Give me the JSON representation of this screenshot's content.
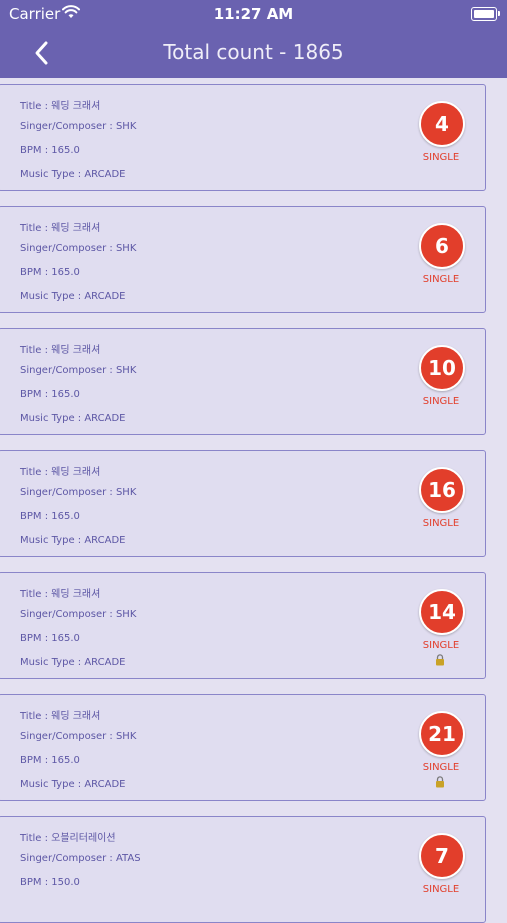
{
  "status_bar": {
    "carrier": "Carrier",
    "time": "11:27 AM"
  },
  "navbar": {
    "title": "Total count - 1865"
  },
  "list": {
    "items": [
      {
        "title": "Title : 웨딩 크래셔",
        "singer": "Singer/Composer : SHK",
        "bpm": "BPM : 165.0",
        "music_type": "Music Type : ARCADE",
        "level": "4",
        "mode": "SINGLE",
        "locked": false
      },
      {
        "title": "Title : 웨딩 크래셔",
        "singer": "Singer/Composer : SHK",
        "bpm": "BPM : 165.0",
        "music_type": "Music Type : ARCADE",
        "level": "6",
        "mode": "SINGLE",
        "locked": false
      },
      {
        "title": "Title : 웨딩 크래셔",
        "singer": "Singer/Composer : SHK",
        "bpm": "BPM : 165.0",
        "music_type": "Music Type : ARCADE",
        "level": "10",
        "mode": "SINGLE",
        "locked": false
      },
      {
        "title": "Title : 웨딩 크래셔",
        "singer": "Singer/Composer : SHK",
        "bpm": "BPM : 165.0",
        "music_type": "Music Type : ARCADE",
        "level": "16",
        "mode": "SINGLE",
        "locked": false
      },
      {
        "title": "Title : 웨딩 크래셔",
        "singer": "Singer/Composer : SHK",
        "bpm": "BPM : 165.0",
        "music_type": "Music Type : ARCADE",
        "level": "14",
        "mode": "SINGLE",
        "locked": true
      },
      {
        "title": "Title : 웨딩 크래셔",
        "singer": "Singer/Composer : SHK",
        "bpm": "BPM : 165.0",
        "music_type": "Music Type : ARCADE",
        "level": "21",
        "mode": "SINGLE",
        "locked": true
      },
      {
        "title": "Title : 오블리터레이션",
        "singer": "Singer/Composer : ATAS",
        "bpm": "BPM : 150.0",
        "music_type": "",
        "level": "7",
        "mode": "SINGLE",
        "locked": false
      }
    ]
  },
  "colors": {
    "header_bg": "#6a62b0",
    "badge_red": "#e23e2b",
    "card_border": "#8a85c9",
    "text_purple": "#5d57a5",
    "page_bg": "#e4e1f1"
  },
  "icons": {
    "back": "chevron-left-icon",
    "wifi": "wifi-icon",
    "battery": "battery-icon",
    "lock": "lock-icon"
  }
}
